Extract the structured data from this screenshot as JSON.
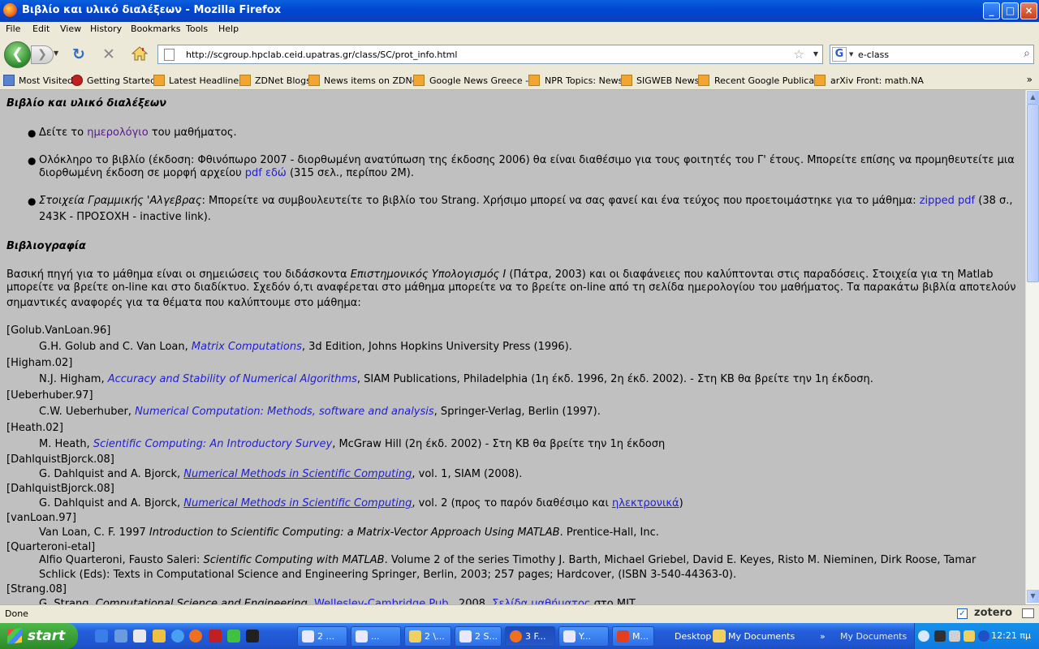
{
  "window": {
    "title": "Βιβλίο και υλικό διαλέξεων - Mozilla Firefox",
    "min": "_",
    "max": "□",
    "close": "×"
  },
  "menu": [
    "File",
    "Edit",
    "View",
    "History",
    "Bookmarks",
    "Tools",
    "Help"
  ],
  "nav": {
    "url": "http://scgroup.hpclab.ceid.upatras.gr/class/SC/prot_info.html",
    "search": "e-class"
  },
  "bookmarks": [
    "Most Visited",
    "Getting Started",
    "Latest Headlines",
    "ZDNet Blogs",
    "News items on ZDNet",
    "Google News Greece - ...",
    "NPR Topics: News",
    "SIGWEB News",
    "Recent Google Publica...",
    "arXiv Front: math.NA"
  ],
  "page": {
    "h1": "Βιβλίο και υλικό διαλέξεων",
    "b1": {
      "pre": "Δείτε το ",
      "link": "ημερολόγιο",
      "post": " του μαθήματος."
    },
    "b2": {
      "l1": "Ολόκληρο το βιβλίο (έκδοση: Φθινόπωρο 2007 - διορθωμένη ανατύπωση της έκδοσης 2006) θα είναι διαθέσιμο για τους φοιτητές του Γ' έτους. Μπορείτε επίσης να προμηθευτείτε μια",
      "l2pre": "διορθωμένη έκδοση σε μορφή αρχείου ",
      "link": "pdf εδώ",
      "l2post": " (315 σελ., περίπου 2Μ)."
    },
    "b3": {
      "em": "Στοιχεία Γραμμικής 'Αλγεβρας",
      "mid": ": Μπορείτε να συμβουλευτείτε το βιβλίο του Strang. Χρήσιμο μπορεί να σας φανεί και ένα τεύχος που προετοιμάστηκε για το μάθημα: ",
      "link": "zipped pdf",
      "post": " (38 σ.,",
      "l2": "243Κ - ΠΡΟΣΟΧΗ - inactive link)."
    },
    "h2": "Βιβλιογραφία",
    "p1": {
      "pre": "Βασική πηγή για το μάθημα είναι οι σημειώσεις του διδάσκοντα ",
      "em": "Επιστημονικός Υπολογισμός Ι",
      "post": " (Πάτρα, 2003) και οι διαφάνειες που καλύπτονται στις παραδόσεις. Στοιχεία για τη Matlab",
      "l2": "μπορείτε να βρείτε on-line και στο διαδίκτυο. Σχεδόν ό,τι αναφέρεται στο μάθημα μπορείτε να το βρείτε on-line από τη σελίδα ημερολογίου του μαθήματος. Τα παρακάτω βιβλία αποτελούν",
      "l3": "σημαντικές αναφορές για τα θέματα που καλύπτουμε στο μάθημα:"
    },
    "refs": [
      {
        "key": "[Golub.VanLoan.96]",
        "pre": "G.H. Golub and C. Van Loan, ",
        "link": "Matrix Computations",
        "post": ", 3d Edition, Johns Hopkins University Press (1996)."
      },
      {
        "key": "[Higham.02]",
        "pre": "N.J. Higham, ",
        "link": "Accuracy and Stability of Numerical Algorithms",
        "post": ", SIAM Publications, Philadelphia (1η έκδ. 1996, 2η έκδ. 2002). - Στη ΚΒ θα βρείτε την 1η έκδοση."
      },
      {
        "key": "[Ueberhuber.97]",
        "pre": "C.W. Ueberhuber, ",
        "link": "Numerical Computation: Methods, software and analysis",
        "post": ", Springer-Verlag, Berlin (1997)."
      },
      {
        "key": "[Heath.02]",
        "pre": "M. Heath, ",
        "link": "Scientific Computing: An Introductory Survey",
        "post": ", McGraw Hill (2η έκδ. 2002) - Στη ΚΒ θα βρείτε την 1η έκδοση"
      },
      {
        "key": "[DahlquistBjorck.08]",
        "pre": "G. Dahlquist and A. Bjorck, ",
        "link": "Numerical Methods in Scientific Computing",
        "post": ", vol. 1, SIAM (2008)."
      },
      {
        "key": "[DahlquistBjorck.08]",
        "pre": "G. Dahlquist and A. Bjorck, ",
        "link": "Numerical Methods in Scientific Computing",
        "post": ", vol. 2 (προς το παρόν διαθέσιμο και ",
        "link2": "ηλεκτρονικά",
        "post2": ")"
      },
      {
        "key": "[vanLoan.97]",
        "pre": "Van Loan, C. F. 1997 ",
        "em": "Introduction to Scientific Computing: a Matrix-Vector Approach Using MATLAB",
        "post": ". Prentice-Hall, Inc."
      },
      {
        "key": "[Quarteroni-etal]",
        "pre": "Alfio Quarteroni, Fausto Saleri: ",
        "em": "Scientific Computing with MATLAB",
        "post": ". Volume 2 of the series Timothy J. Barth, Michael Griebel, David E. Keyes, Risto M. Nieminen, Dirk Roose, Tamar",
        "l2": "Schlick (Eds): Texts in Computational Science and Engineering Springer, Berlin, 2003; 257 pages; Hardcover, (ISBN 3-540-44363-0)."
      },
      {
        "key": "[Strang.08]",
        "pre": "G. Strang, ",
        "em": "Computational Science and Engineering",
        "post": ", ",
        "link": "Wellesley-Cambridge Pub.",
        "post2": ", 2008, ",
        "link2": "Σελίδα μαθήματος",
        "post3": " στο MIT"
      }
    ]
  },
  "status": {
    "text": "Done",
    "zotero": "zotero"
  },
  "taskbar": {
    "start": "start",
    "tasks": [
      "2 ...",
      "...",
      "2 \\...",
      "2 S...",
      "3 F...",
      "Y...",
      "M..."
    ],
    "desktop": "Desktop",
    "mydocs": "My Documents",
    "mydocs2": "My Documents",
    "clock": "12:21 πμ"
  }
}
